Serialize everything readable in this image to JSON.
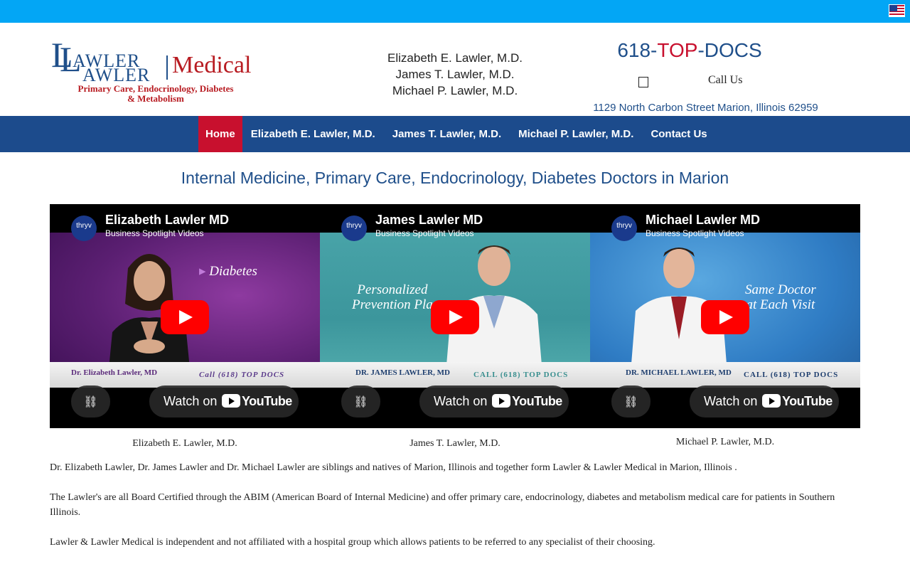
{
  "topbar": {
    "flag_icon": "us-flag-icon",
    "color": "#03a6f5"
  },
  "logo": {
    "ll": "LL",
    "line1": "AWLER",
    "line2": "AWLER",
    "medical": "Medical",
    "tagline_1": "Primary Care, Endocrinology, Diabetes",
    "tagline_2": "& Metabolism"
  },
  "doctors_header": [
    "Elizabeth E. Lawler, M.D.",
    "James T. Lawler, M.D.",
    "Michael P. Lawler, M.D."
  ],
  "contact": {
    "phone_prefix": "618-",
    "phone_mid": "TOP",
    "phone_suffix": "-DOCS",
    "call_us": "Call Us",
    "address": "1129 North Carbon Street Marion, Illinois 62959"
  },
  "nav": {
    "items": [
      {
        "label": "Home",
        "active": true
      },
      {
        "label": "Elizabeth E. Lawler, M.D."
      },
      {
        "label": "James T. Lawler, M.D."
      },
      {
        "label": "Michael P. Lawler, M.D."
      },
      {
        "label": "Contact Us"
      }
    ]
  },
  "headline": "Internal Medicine, Primary Care, Endocrinology, Diabetes Doctors in Marion",
  "videos": [
    {
      "channel": "thryv",
      "title": "Elizabeth Lawler MD",
      "subtitle": "Business Spotlight Videos",
      "overlay_text": "Diabetes",
      "band_name": "Dr. Elizabeth Lawler, MD",
      "band_call": "Call (618) TOP DOCS",
      "watch_on": "Watch on",
      "youtube": "YouTube",
      "caption": "Elizabeth E. Lawler, M.D."
    },
    {
      "channel": "thryv",
      "title": "James Lawler MD",
      "subtitle": "Business Spotlight Videos",
      "overlay_text_1": "Personalized",
      "overlay_text_2": "Prevention Pla",
      "band_name": "DR. JAMES LAWLER, MD",
      "band_call": "CALL (618) TOP DOCS",
      "watch_on": "Watch on",
      "youtube": "YouTube",
      "caption": "James T. Lawler, M.D."
    },
    {
      "channel": "thryv",
      "title": "Michael Lawler MD",
      "subtitle": "Business Spotlight Videos",
      "overlay_text_1": "Same Doctor",
      "overlay_text_2": "at Each Visit",
      "band_name": "DR. MICHAEL LAWLER, MD",
      "band_call": "CALL (618) TOP DOCS",
      "watch_on": "Watch on",
      "youtube": "YouTube",
      "caption": "Michael P. Lawler, M.D."
    }
  ],
  "paragraphs": [
    "Dr. Elizabeth Lawler, Dr. James Lawler and Dr. Michael Lawler  are siblings and natives of Marion, Illinois and together form Lawler & Lawler Medical in Marion, Illinois .",
    "The Lawler's are all Board Certified through the ABIM (American Board of Internal Medicine) and offer primary care, endocrinology, diabetes and metabolism medical care for patients in Southern Illinois.",
    "Lawler & Lawler Medical is independent and not affiliated with a hospital group which allows  patients to be referred to any specialist of their choosing."
  ],
  "colors": {
    "brand_blue": "#1f4f8a",
    "nav_blue": "#1c4b8c",
    "brand_red": "#c8102e",
    "topbar": "#03a6f5"
  }
}
